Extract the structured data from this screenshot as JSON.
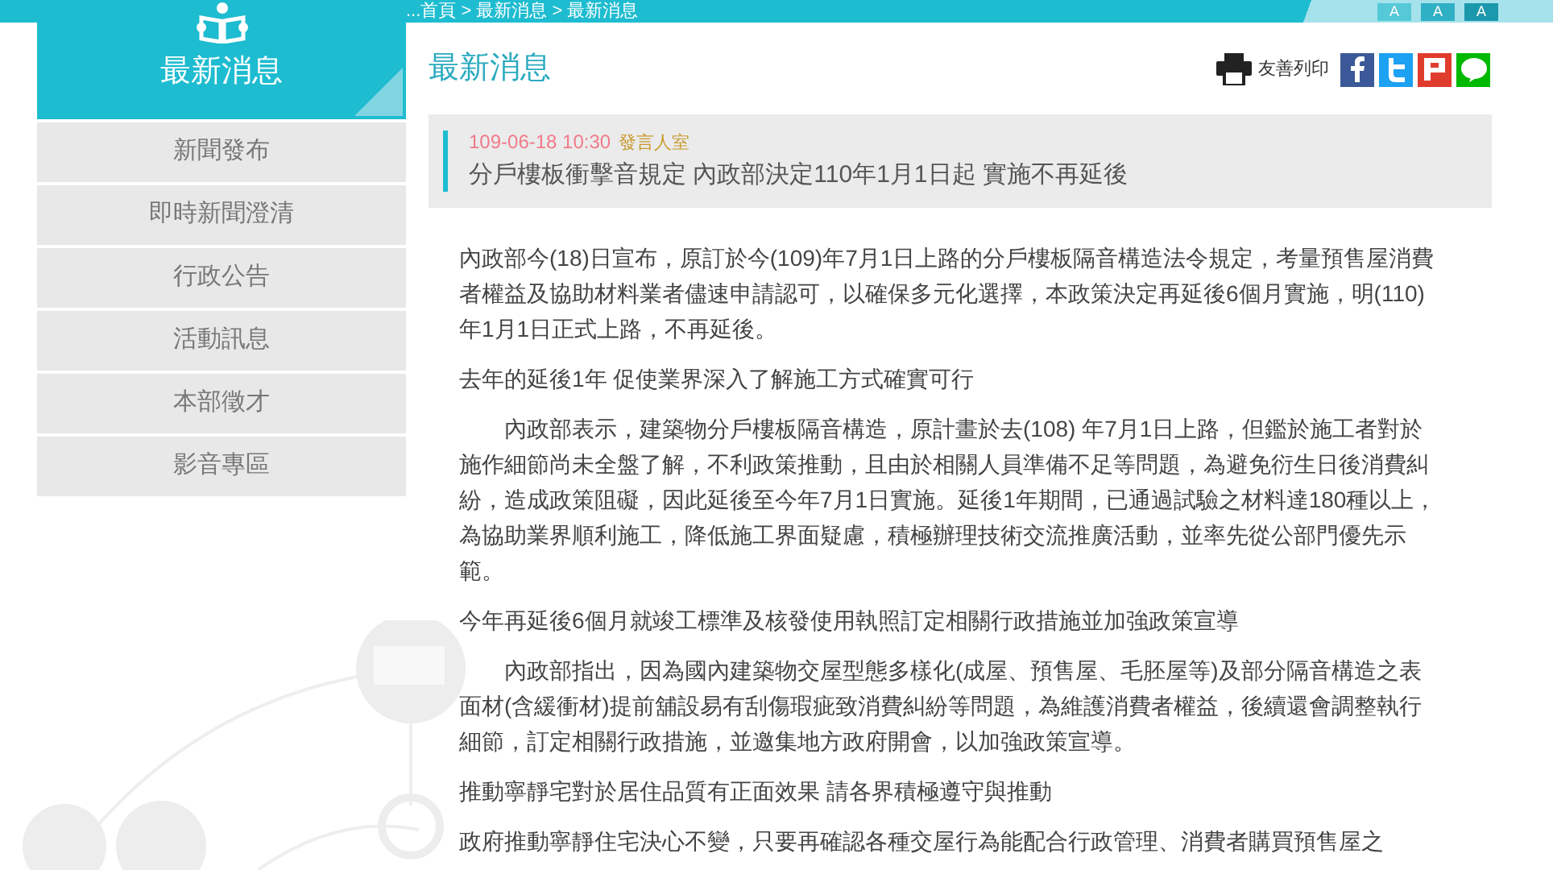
{
  "breadcrumb": "...首頁 > 最新消息 > 最新消息",
  "font_size_buttons": [
    "A",
    "A",
    "A"
  ],
  "sidebar": {
    "title": "最新消息",
    "items": [
      "新聞發布",
      "即時新聞澄清",
      "行政公告",
      "活動訊息",
      "本部徵才",
      "影音專區"
    ]
  },
  "page_title": "最新消息",
  "print_label": "友善列印",
  "article": {
    "date": "109-06-18 10:30",
    "unit": "發言人室",
    "title": "分戶樓板衝擊音規定 內政部決定110年1月1日起 實施不再延後",
    "paragraphs": [
      {
        "text": "內政部今(18)日宣布，原訂於今(109)年7月1日上路的分戶樓板隔音構造法令規定，考量預售屋消費者權益及協助材料業者儘速申請認可，以確保多元化選擇，本政策決定再延後6個月實施，明(110)年1月1日正式上路，不再延後。",
        "indent": false
      },
      {
        "text": "去年的延後1年 促使業界深入了解施工方式確實可行",
        "indent": false
      },
      {
        "text": "內政部表示，建築物分戶樓板隔音構造，原計畫於去(108) 年7月1日上路，但鑑於施工者對於施作細節尚未全盤了解，不利政策推動，且由於相關人員準備不足等問題，為避免衍生日後消費糾紛，造成政策阻礙，因此延後至今年7月1日實施。延後1年期間，已通過試驗之材料達180種以上，為協助業界順利施工，降低施工界面疑慮，積極辦理技術交流推廣活動，並率先從公部門優先示範。",
        "indent": true
      },
      {
        "text": "今年再延後6個月就竣工標準及核發使用執照訂定相關行政措施並加強政策宣導",
        "indent": false
      },
      {
        "text": "內政部指出，因為國內建築物交屋型態多樣化(成屋、預售屋、毛胚屋等)及部分隔音構造之表面材(含緩衝材)提前舖設易有刮傷瑕疵致消費糾紛等問題，為維護消費者權益，後續還會調整執行細節，訂定相關行政措施，並邀集地方政府開會，以加強政策宣導。",
        "indent": true
      },
      {
        "text": "推動寧靜宅對於居住品質有正面效果 請各界積極遵守與推動",
        "indent": false
      },
      {
        "text": "政府推動寧靜住宅決心不變，只要再確認各種交屋行為能配合行政管理、消費者購買預售屋之",
        "indent": false
      }
    ]
  }
}
